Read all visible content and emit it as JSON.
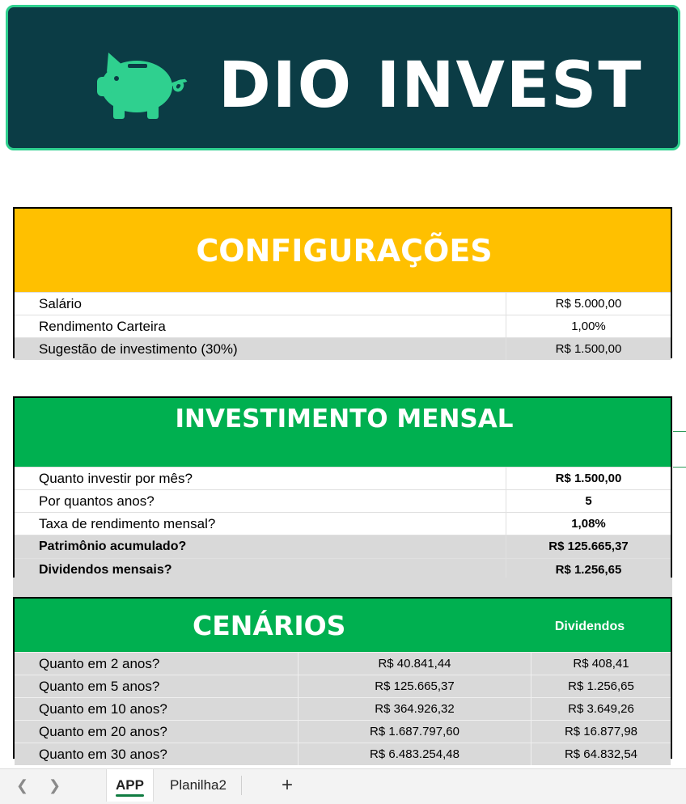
{
  "banner": {
    "brand": "DIO INVEST",
    "icon": "piggy-bank-icon",
    "bg_color": "#0b3c45",
    "accent_color": "#2fd08f"
  },
  "configuracoes": {
    "title": "CONFIGURAÇÕES",
    "header_color": "#ffc000",
    "rows": [
      {
        "label": "Salário",
        "value": "R$ 5.000,00"
      },
      {
        "label": "Rendimento Carteira",
        "value": "1,00%"
      },
      {
        "label": "Sugestão de investimento (30%)",
        "value": "R$ 1.500,00"
      }
    ]
  },
  "investimento": {
    "title": "INVESTIMENTO MENSAL",
    "header_color": "#00b050",
    "rows": [
      {
        "label": "Quanto investir por mês?",
        "value": "R$ 1.500,00"
      },
      {
        "label": "Por quantos anos?",
        "value": "5"
      },
      {
        "label": "Taxa de rendimento mensal?",
        "value": "1,08%"
      },
      {
        "label": "Patrimônio acumulado?",
        "value": "R$ 125.665,37"
      },
      {
        "label": "Dividendos mensais?",
        "value": "R$ 1.256,65"
      }
    ]
  },
  "cenarios": {
    "title": "CENÁRIOS",
    "dividends_header": "Dividendos",
    "rows": [
      {
        "label": "Quanto em 2 anos?",
        "value": "R$ 40.841,44",
        "dividendos": "R$ 408,41"
      },
      {
        "label": "Quanto em 5 anos?",
        "value": "R$ 125.665,37",
        "dividendos": "R$ 1.256,65"
      },
      {
        "label": "Quanto em 10 anos?",
        "value": "R$ 364.926,32",
        "dividendos": "R$ 3.649,26"
      },
      {
        "label": "Quanto em 20 anos?",
        "value": "R$ 1.687.797,60",
        "dividendos": "R$ 16.877,98"
      },
      {
        "label": "Quanto em 30 anos?",
        "value": "R$ 6.483.254,48",
        "dividendos": "R$ 64.832,54"
      }
    ]
  },
  "sheet_tabs": {
    "prev_icon": "chevron-left-icon",
    "next_icon": "chevron-right-icon",
    "tabs": [
      {
        "label": "APP",
        "active": true
      },
      {
        "label": "Planilha2",
        "active": false
      }
    ],
    "add_label": "+"
  }
}
